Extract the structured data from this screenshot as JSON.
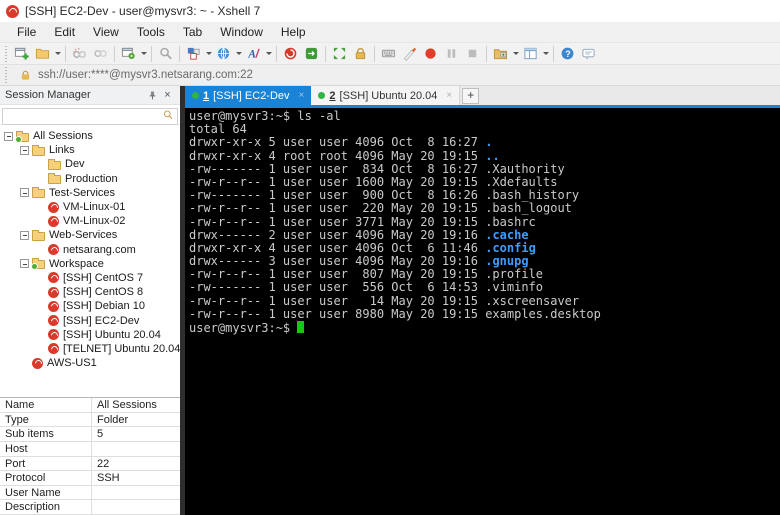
{
  "window": {
    "title": "[SSH] EC2-Dev - user@mysvr3: ~ - Xshell 7"
  },
  "menu": {
    "items": [
      "File",
      "Edit",
      "View",
      "Tools",
      "Tab",
      "Window",
      "Help"
    ]
  },
  "toolbar": {
    "icon_names": [
      "new-session",
      "open-session",
      "disconnect",
      "reconnect",
      "session-properties",
      "find",
      "color-scheme",
      "encoding",
      "font",
      "new-xshell",
      "new-xftp",
      "full-screen",
      "lock",
      "on-screen-keyboard",
      "compose-bar",
      "record-session",
      "pause-record",
      "stop-record",
      "transfer-folder",
      "tile-windows",
      "help",
      "feedback"
    ]
  },
  "address": {
    "url": "ssh://user:****@mysvr3.netsarang.com:22"
  },
  "session_manager": {
    "title": "Session Manager",
    "search_placeholder": "",
    "tree": [
      {
        "depth": 0,
        "icon": "folder-active",
        "label": "All Sessions",
        "expander": true
      },
      {
        "depth": 1,
        "icon": "folder",
        "label": "Links",
        "expander": true
      },
      {
        "depth": 2,
        "icon": "folder",
        "label": "Dev",
        "expander": false
      },
      {
        "depth": 2,
        "icon": "folder",
        "label": "Production",
        "expander": false
      },
      {
        "depth": 1,
        "icon": "folder",
        "label": "Test-Services",
        "expander": true
      },
      {
        "depth": 2,
        "icon": "session",
        "label": "VM-Linux-01",
        "expander": false
      },
      {
        "depth": 2,
        "icon": "session",
        "label": "VM-Linux-02",
        "expander": false
      },
      {
        "depth": 1,
        "icon": "folder",
        "label": "Web-Services",
        "expander": true
      },
      {
        "depth": 2,
        "icon": "session",
        "label": "netsarang.com",
        "expander": false
      },
      {
        "depth": 1,
        "icon": "folder-active",
        "label": "Workspace",
        "expander": true
      },
      {
        "depth": 2,
        "icon": "session",
        "label": "[SSH] CentOS 7",
        "expander": false
      },
      {
        "depth": 2,
        "icon": "session",
        "label": "[SSH] CentOS 8",
        "expander": false
      },
      {
        "depth": 2,
        "icon": "session",
        "label": "[SSH] Debian 10",
        "expander": false
      },
      {
        "depth": 2,
        "icon": "session",
        "label": "[SSH] EC2-Dev",
        "expander": false
      },
      {
        "depth": 2,
        "icon": "session",
        "label": "[SSH] Ubuntu 20.04",
        "expander": false
      },
      {
        "depth": 2,
        "icon": "session",
        "label": "[TELNET] Ubuntu 20.04",
        "expander": false
      },
      {
        "depth": 1,
        "icon": "session",
        "label": "AWS-US1",
        "expander": false
      }
    ]
  },
  "properties": {
    "rows": [
      {
        "label": "Name",
        "value": "All Sessions"
      },
      {
        "label": "Type",
        "value": "Folder"
      },
      {
        "label": "Sub items",
        "value": "5"
      },
      {
        "label": "Host",
        "value": ""
      },
      {
        "label": "Port",
        "value": "22"
      },
      {
        "label": "Protocol",
        "value": "SSH"
      },
      {
        "label": "User Name",
        "value": ""
      },
      {
        "label": "Description",
        "value": ""
      }
    ]
  },
  "tabs": {
    "items": [
      {
        "number": "1",
        "label": "[SSH] EC2-Dev",
        "active": true,
        "close_label": "×"
      },
      {
        "number": "2",
        "label": "[SSH] Ubuntu 20.04",
        "active": false,
        "close_label": "×"
      }
    ],
    "new_tab_label": "+"
  },
  "terminal": {
    "lines": [
      "user@mysvr3:~$ ls -al",
      "total 64",
      [
        "drwxr-xr-x 5 user user 4096 Oct  8 16:27 ",
        {
          "t": ".",
          "c": "dir"
        }
      ],
      [
        "drwxr-xr-x 4 root root 4096 May 20 19:15 ",
        {
          "t": "..",
          "c": "dir"
        }
      ],
      "-rw------- 1 user user  834 Oct  8 16:27 .Xauthority",
      "-rw-r--r-- 1 user user 1600 May 20 19:15 .Xdefaults",
      "-rw------- 1 user user  900 Oct  8 16:26 .bash_history",
      "-rw-r--r-- 1 user user  220 May 20 19:15 .bash_logout",
      "-rw-r--r-- 1 user user 3771 May 20 19:15 .bashrc",
      [
        "drwx------ 2 user user 4096 May 20 19:16 ",
        {
          "t": ".cache",
          "c": "dir"
        }
      ],
      [
        "drwxr-xr-x 4 user user 4096 Oct  6 11:46 ",
        {
          "t": ".config",
          "c": "dir"
        }
      ],
      [
        "drwx------ 3 user user 4096 May 20 19:16 ",
        {
          "t": ".gnupg",
          "c": "dir"
        }
      ],
      "-rw-r--r-- 1 user user  807 May 20 19:15 .profile",
      "-rw------- 1 user user  556 Oct  6 14:53 .viminfo",
      "-rw-r--r-- 1 user user   14 May 20 19:15 .xscreensaver",
      "-rw-r--r-- 1 user user 8980 May 20 19:15 examples.desktop",
      [
        "user@mysvr3:~$ ",
        {
          "t": " ",
          "c": "cursor"
        }
      ]
    ]
  },
  "colors": {
    "accent_blue": "#1883d7",
    "tab_green_dot": "#2fb344",
    "terminal_bg": "#000000",
    "terminal_fg": "#cacaca",
    "terminal_dir_blue": "#3b9eff",
    "terminal_cursor_green": "#1bc41b",
    "session_icon_red": "#d93a2b",
    "folder_yellow": "#f6d07c",
    "lock_orange": "#e8b950"
  }
}
